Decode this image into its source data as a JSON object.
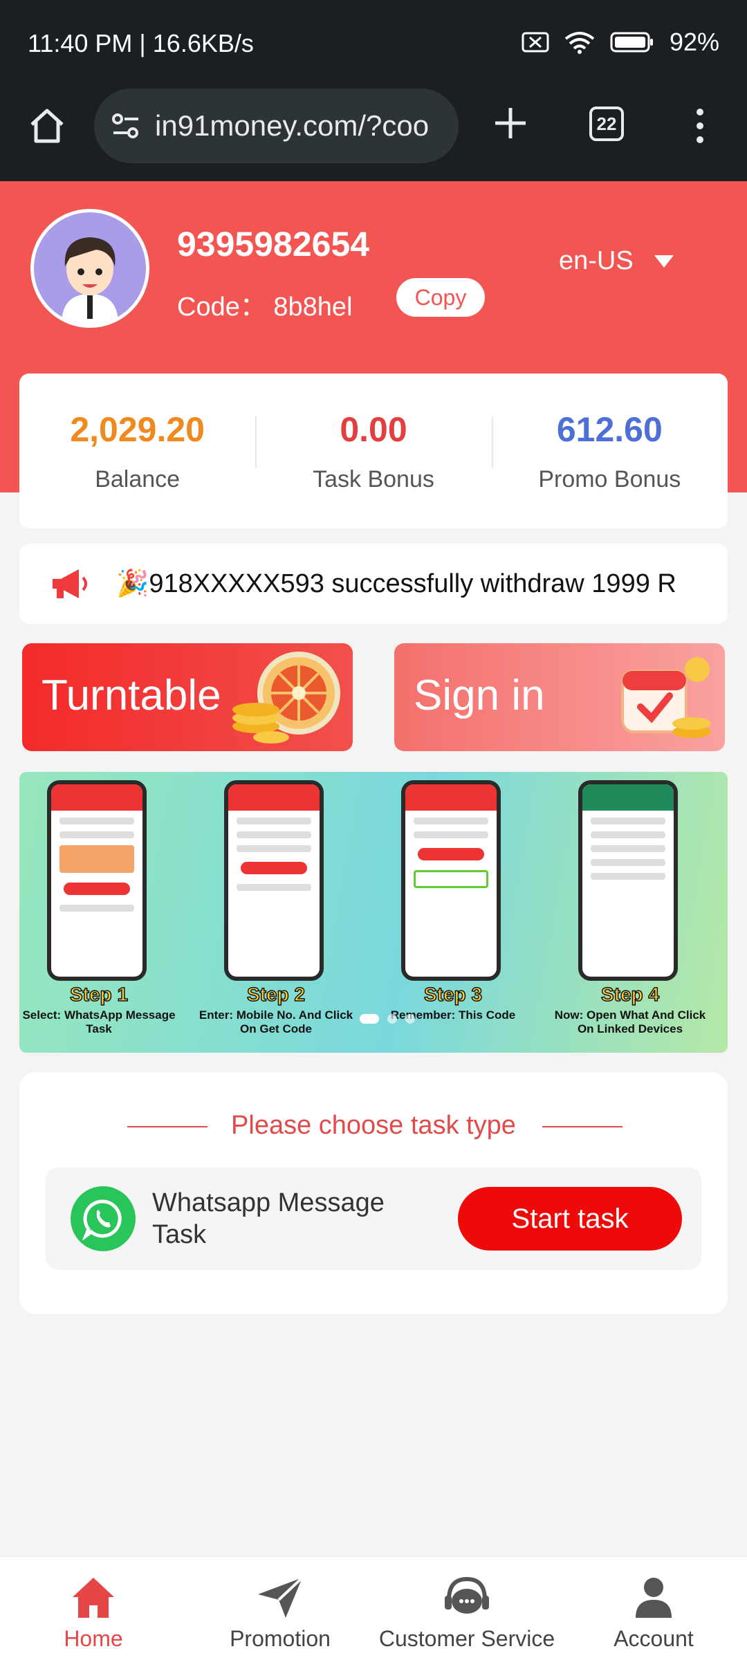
{
  "status_bar": {
    "time": "11:40 PM | 16.6KB/s",
    "battery": "92%"
  },
  "browser": {
    "url": "in91money.com/?coo",
    "tab_count": "22"
  },
  "header": {
    "phone": "9395982654",
    "code": "Code：  8b8hel",
    "copy_label": "Copy",
    "language": "en-US"
  },
  "stats": [
    {
      "value": "2,029.20",
      "label": "Balance",
      "color": "#f0891e"
    },
    {
      "value": "0.00",
      "label": "Task Bonus",
      "color": "#e43f3f"
    },
    {
      "value": "612.60",
      "label": "Promo Bonus",
      "color": "#4e6fd8"
    }
  ],
  "ticker": {
    "text": "🎉918XXXXX593 successfully withdraw 1999 R"
  },
  "promos": {
    "turntable": "Turntable",
    "signin": "Sign in"
  },
  "banner": {
    "steps": [
      {
        "title": "Step 1",
        "desc": "Select: WhatsApp Message Task"
      },
      {
        "title": "Step 2",
        "desc": "Enter: Mobile No. And Click On Get Code"
      },
      {
        "title": "Step 3",
        "desc": "Remember: This Code"
      },
      {
        "title": "Step 4",
        "desc": "Now: Open What And Click On Linked Devices"
      }
    ]
  },
  "tasks": {
    "title": "Please choose task type",
    "items": [
      {
        "name": "Whatsapp Message Task",
        "button": "Start task"
      }
    ]
  },
  "nav": [
    {
      "label": "Home",
      "icon": "home-icon",
      "active": true
    },
    {
      "label": "Promotion",
      "icon": "send-icon",
      "active": false
    },
    {
      "label": "Customer Service",
      "icon": "headset-icon",
      "active": false
    },
    {
      "label": "Account",
      "icon": "user-icon",
      "active": false
    }
  ]
}
